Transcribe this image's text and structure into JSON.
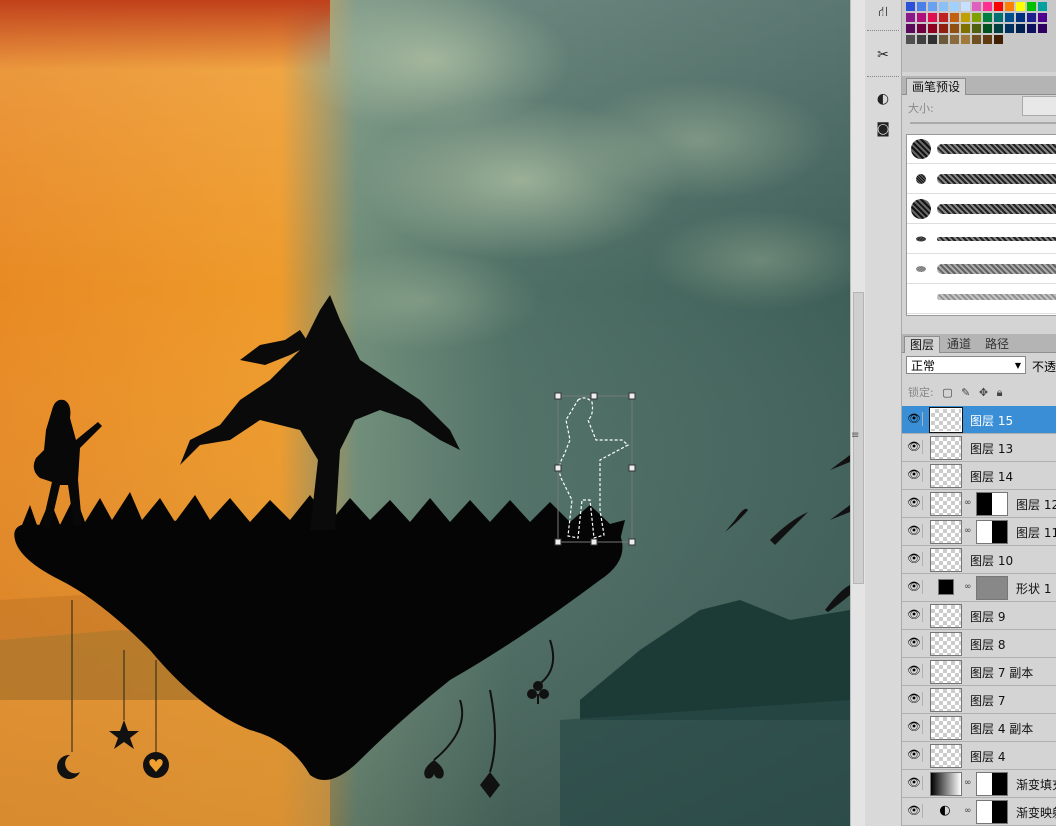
{
  "brush_panel": {
    "tab": "画笔预设",
    "size_label": "大小:"
  },
  "layers_panel": {
    "tabs": [
      "图层",
      "通道",
      "路径"
    ],
    "blend_mode": "正常",
    "opacity_label": "不透",
    "lock_label": "锁定:",
    "layers": [
      {
        "name": "图层 15",
        "selected": true,
        "thumb": "transparent",
        "mask": "none"
      },
      {
        "name": "图层 13",
        "selected": false,
        "thumb": "transparent",
        "mask": "none"
      },
      {
        "name": "图层 14",
        "selected": false,
        "thumb": "transparent",
        "mask": "none"
      },
      {
        "name": "图层 12",
        "selected": false,
        "thumb": "transparent",
        "mask": "half"
      },
      {
        "name": "图层 11",
        "selected": false,
        "thumb": "transparent",
        "mask": "halfw"
      },
      {
        "name": "图层 10",
        "selected": false,
        "thumb": "transparent",
        "mask": "none"
      },
      {
        "name": "形状 1",
        "selected": false,
        "thumb": "black",
        "mask": "grey"
      },
      {
        "name": "图层 9",
        "selected": false,
        "thumb": "transparent",
        "mask": "none"
      },
      {
        "name": "图层 8",
        "selected": false,
        "thumb": "transparent",
        "mask": "none"
      },
      {
        "name": "图层 7 副本",
        "selected": false,
        "thumb": "transparent",
        "mask": "none"
      },
      {
        "name": "图层 7",
        "selected": false,
        "thumb": "transparent",
        "mask": "none"
      },
      {
        "name": "图层 4 副本",
        "selected": false,
        "thumb": "transparent",
        "mask": "none"
      },
      {
        "name": "图层 4",
        "selected": false,
        "thumb": "transparent",
        "mask": "none"
      },
      {
        "name": "渐变填充",
        "selected": false,
        "thumb": "grad",
        "mask": "halfw"
      },
      {
        "name": "渐变映射",
        "selected": false,
        "thumb": "icon",
        "mask": "halfw"
      }
    ]
  },
  "swatch_colors": [
    "#2a4fd8",
    "#4a7fe8",
    "#6aa0f0",
    "#8ac0f8",
    "#a0d0ff",
    "#c8e0ff",
    "#e060c0",
    "#ff3090",
    "#ff0000",
    "#ff8000",
    "#ffff00",
    "#00c000",
    "#00a0a0",
    "#8a1a8a",
    "#b0107a",
    "#e01050",
    "#c02020",
    "#c06010",
    "#c0a000",
    "#80a000",
    "#008040",
    "#007070",
    "#005090",
    "#003080",
    "#202090",
    "#500090",
    "#5a0a5a",
    "#700040",
    "#900020",
    "#902010",
    "#905010",
    "#807000",
    "#506010",
    "#005020",
    "#004040",
    "#003060",
    "#002050",
    "#101060",
    "#300060",
    "#505050",
    "#404040",
    "#303030",
    "#6a5a3a",
    "#8a6a3a",
    "#a07a3a",
    "#705020",
    "#603a10",
    "#402000"
  ]
}
